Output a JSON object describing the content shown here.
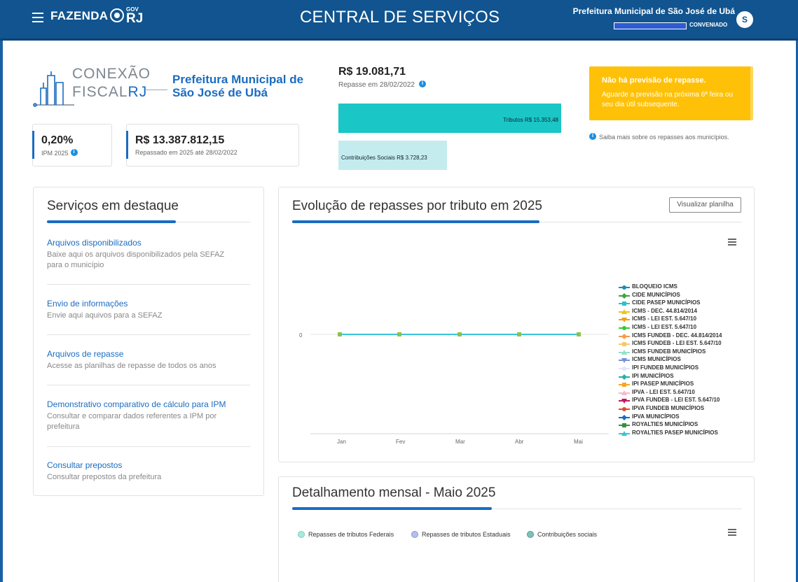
{
  "header": {
    "brand": "FAZENDA",
    "brand_gov": "GOV",
    "brand_rj": "RJ",
    "title": "CENTRAL DE SERVIÇOS",
    "org": "Prefeitura Municipal de São José de Ubá",
    "role": "CONVENIADO",
    "avatar": "S"
  },
  "logo": {
    "line1": "CONEXÃO",
    "line2": "FISCAL",
    "line2_accent": "RJ"
  },
  "municipio": "Prefeitura Municipal de São José de Ubá",
  "ipm": {
    "value": "0,20%",
    "label": "IPM 2025"
  },
  "repassado": {
    "value": "R$ 13.387.812,15",
    "label": "Repassado em 2025 até 28/02/2022"
  },
  "repasse": {
    "value": "R$ 19.081,71",
    "date": "Repasse em 28/02/2022",
    "tributos_label": "Tributos R$ 15.353,48",
    "contrib_label": "Contribuições Sociais R$ 3.728,23",
    "tributos_share": 0.8046,
    "contrib_share": 0.1954
  },
  "alert": {
    "title": "Não há previsão de repasse.",
    "body": "Aguarde a previsão na próxima 6ª feira ou seu dia útil subsequente."
  },
  "saiba": "Saiba mais sobre os repasses aos municípios.",
  "services": {
    "title": "Serviços em destaque",
    "items": [
      {
        "title": "Arquivos disponibilizados",
        "desc": "Baixe aqui os arquivos disponibilizados pela SEFAZ para o município"
      },
      {
        "title": "Envio de informações",
        "desc": "Envie aqui aquivos para a SEFAZ"
      },
      {
        "title": "Arquivos de repasse",
        "desc": "Acesse as planilhas de repasse de todos os anos"
      },
      {
        "title": "Demonstrativo comparativo de cálculo para IPM",
        "desc": "Consultar e comparar dados referentes a IPM por prefeitura"
      },
      {
        "title": "Consultar prepostos",
        "desc": "Consultar prepostos da prefeitura"
      }
    ]
  },
  "evolucao": {
    "title": "Evolução de repasses por tributo em 2025",
    "button": "Visualizar planilha",
    "menu_icon": "hamburger-icon"
  },
  "chart_data": {
    "type": "line",
    "title": "Evolução de repasses por tributo em 2025",
    "categories": [
      "Jan",
      "Fev",
      "Mar",
      "Abr",
      "Mai"
    ],
    "yticks": [
      "0"
    ],
    "series": [
      {
        "name": "BLOQUEIO ICMS",
        "color": "#1a8fb0",
        "marker": "circle",
        "values": [
          0,
          0,
          0,
          0,
          0
        ]
      },
      {
        "name": "CIDE MUNICÍPIOS",
        "color": "#3aa63a",
        "marker": "diamond",
        "values": [
          0,
          0,
          0,
          0,
          0
        ]
      },
      {
        "name": "CIDE PASEP MUNICÍPIOS",
        "color": "#2ec0c8",
        "marker": "square",
        "values": [
          0,
          0,
          0,
          0,
          0
        ]
      },
      {
        "name": "ICMS - DEC. 44.814/2014",
        "color": "#f0c419",
        "marker": "triangle",
        "values": [
          0,
          0,
          0,
          0,
          0
        ]
      },
      {
        "name": "ICMS - LEI EST. 5.647/10",
        "color": "#e8a317",
        "marker": "triangle-down",
        "values": [
          0,
          0,
          0,
          0,
          0
        ]
      },
      {
        "name": "ICMS - LEI EST. 5.647/10",
        "color": "#37c837",
        "marker": "circle",
        "values": [
          0,
          0,
          0,
          0,
          0
        ]
      },
      {
        "name": "ICMS FUNDEB - DEC. 44.814/2014",
        "color": "#f59b4a",
        "marker": "diamond",
        "values": [
          0,
          0,
          0,
          0,
          0
        ]
      },
      {
        "name": "ICMS FUNDEB - LEI EST. 5.647/10",
        "color": "#f7c96b",
        "marker": "square",
        "values": [
          0,
          0,
          0,
          0,
          0
        ]
      },
      {
        "name": "ICMS FUNDEB MUNICÍPIOS",
        "color": "#8fe3c6",
        "marker": "triangle",
        "values": [
          0,
          0,
          0,
          0,
          0
        ]
      },
      {
        "name": "ICMS MUNICÍPIOS",
        "color": "#7a8fd8",
        "marker": "triangle-down",
        "values": [
          0,
          0,
          0,
          0,
          0
        ]
      },
      {
        "name": "IPI FUNDEB MUNICÍPIOS",
        "color": "#e0e6f5",
        "marker": "circle",
        "values": [
          0,
          0,
          0,
          0,
          0
        ]
      },
      {
        "name": "IPI MUNICÍPIOS",
        "color": "#25b0a8",
        "marker": "diamond",
        "values": [
          0,
          0,
          0,
          0,
          0
        ]
      },
      {
        "name": "IPI PASEP MUNICÍPIOS",
        "color": "#f5a623",
        "marker": "square",
        "values": [
          0,
          0,
          0,
          0,
          0
        ]
      },
      {
        "name": "IPVA - LEI EST. 5.647/10",
        "color": "#f7b6d2",
        "marker": "triangle",
        "values": [
          0,
          0,
          0,
          0,
          0
        ]
      },
      {
        "name": "IPVA FUNDEB - LEI EST. 5.647/10",
        "color": "#c2185b",
        "marker": "triangle-down",
        "values": [
          0,
          0,
          0,
          0,
          0
        ]
      },
      {
        "name": "IPVA FUNDEB MUNICÍPIOS",
        "color": "#e24a2c",
        "marker": "circle",
        "values": [
          0,
          0,
          0,
          0,
          0
        ]
      },
      {
        "name": "IPVA MUNICÍPIOS",
        "color": "#1a6cc2",
        "marker": "diamond",
        "values": [
          0,
          0,
          0,
          0,
          0
        ]
      },
      {
        "name": "ROYALTIES MUNICÍPIOS",
        "color": "#3a8f3a",
        "marker": "square",
        "values": [
          0,
          0,
          0,
          0,
          0
        ]
      },
      {
        "name": "ROYALTIES PASEP MUNICÍPIOS",
        "color": "#38c4d8",
        "marker": "triangle",
        "values": [
          0,
          0,
          0,
          0,
          0
        ]
      }
    ],
    "legend": "right",
    "grid": false
  },
  "detalhamento": {
    "title": "Detalhamento mensal - Maio 2025",
    "legend": [
      {
        "label": "Repasses de tributos Federais",
        "color": "#a8ead8"
      },
      {
        "label": "Repasses de tributos Estaduais",
        "color": "#b5bff0"
      },
      {
        "label": "Contribuições sociais",
        "color": "#7fbfb8"
      }
    ]
  }
}
